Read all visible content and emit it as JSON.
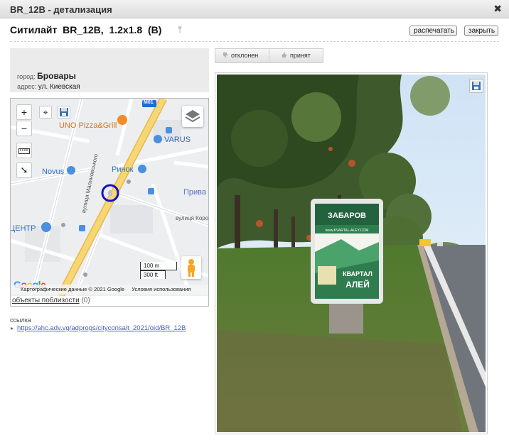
{
  "window": {
    "title": "BR_12B - детализация"
  },
  "header": {
    "title": "Ситилайт  BR_12B,  1.2x1.8  (B)",
    "print_label": "распечатать",
    "close_label": "закрыть"
  },
  "info": {
    "city_label": "город:",
    "city_value": "Бровары",
    "address_label": "адрес:",
    "address_value": "ул. Киевская"
  },
  "map": {
    "labels": {
      "road_badge": "M01",
      "uno": "UNO Pizza&Grill",
      "varus": "VARUS",
      "novus": "Novus",
      "rynok": "Ринок",
      "pryva": "Прива",
      "centr": "ЦЕНТР",
      "street_malynovskogo": "вулиця Малиновського",
      "street_kor": "вулиця Корольова"
    },
    "zoom_in": "+",
    "zoom_out": "−",
    "scale_metric": "100 m",
    "scale_imperial": "300 ft",
    "google_logo": "Google",
    "attribution": "Картографические данные © 2021 Google",
    "terms": "Условия использования",
    "colors": {
      "road": "#f5d26a",
      "pin": "#1212cc",
      "poi_blue": "#4a8fe0",
      "poi_orange": "#f28c28"
    }
  },
  "nearby": {
    "link": "объекты поблизости",
    "count": "(0)"
  },
  "link": {
    "label": "ссылка",
    "url": "https://ahc.adv.vg/adprogs/cityconsalt_2021/oid/BR_12B"
  },
  "vote": {
    "reject": "отклонен",
    "accept": "принят"
  },
  "photo": {
    "billboard_top": "ЗАБАРОВ",
    "billboard_site": "www.KVARTAL-ALEY.COM",
    "billboard_brand_1": "КВАРТАЛ",
    "billboard_brand_2": "АЛЕЙ"
  }
}
